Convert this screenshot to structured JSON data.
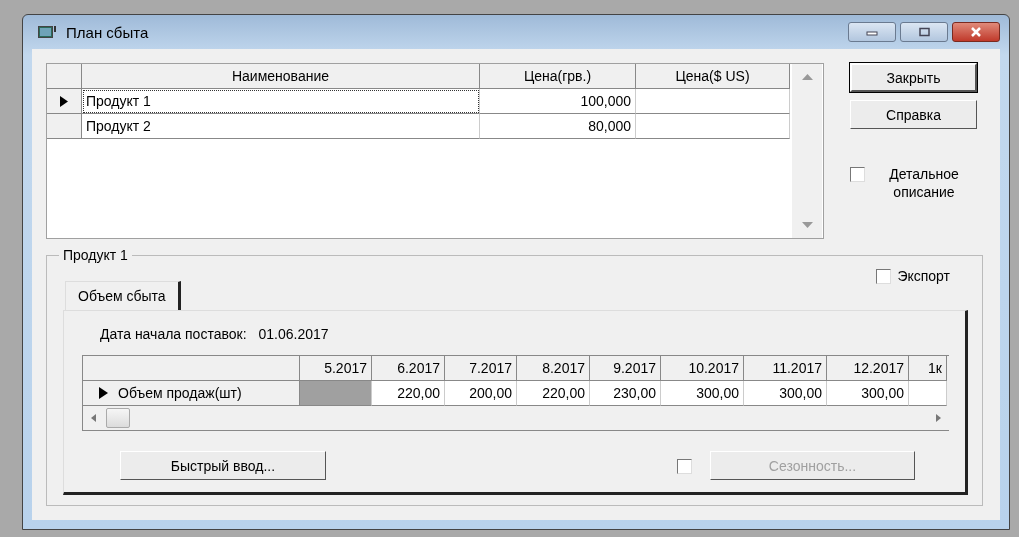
{
  "window": {
    "title": "План сбыта"
  },
  "products_table": {
    "columns": [
      "Наименование",
      "Цена(грв.)",
      "Цена($ US)"
    ],
    "rows": [
      {
        "selected": true,
        "cells": [
          "Продукт 1",
          "100,000"
        ]
      },
      {
        "selected": false,
        "cells": [
          "Продукт 2",
          "80,000"
        ]
      }
    ]
  },
  "buttons": [
    {
      "label": "Закрыть",
      "default": true
    },
    {
      "label": "Справка",
      "default": false
    }
  ],
  "detail_checkbox": {
    "label": "Детальное описание",
    "checked": false
  },
  "group": {
    "title": "Продукт 1",
    "export_checkbox": {
      "label": "Экспорт",
      "checked": false
    },
    "tabs": [
      {
        "label": "Объем сбыта",
        "selected": true
      }
    ],
    "start_date": {
      "label": "Дата начала поставок:",
      "value": "01.06.2017"
    },
    "sales_grid": {
      "columns": [
        "5.2017",
        "6.2017",
        "7.2017",
        "8.2017",
        "9.2017",
        "10.2017",
        "11.2017",
        "12.2017",
        "1к"
      ],
      "rows": [
        {
          "label": "Объем продаж(шт)",
          "selected": true,
          "cells": [
            {
              "kind": "blank"
            },
            {
              "kind": "value",
              "text": "220,00"
            },
            {
              "kind": "value",
              "text": "200,00"
            },
            {
              "kind": "value",
              "text": "220,00"
            },
            {
              "kind": "value",
              "text": "230,00"
            },
            {
              "kind": "value",
              "text": "300,00"
            },
            {
              "kind": "value",
              "text": "300,00"
            },
            {
              "kind": "value",
              "text": "300,00"
            },
            {
              "kind": "empty"
            }
          ]
        }
      ]
    },
    "quick_input_button": {
      "label": "Быстрый ввод...",
      "disabled": false
    },
    "seasonal_checkbox": {
      "checked": false
    },
    "seasonal_button": {
      "label": "Сезонность...",
      "disabled": true
    }
  }
}
